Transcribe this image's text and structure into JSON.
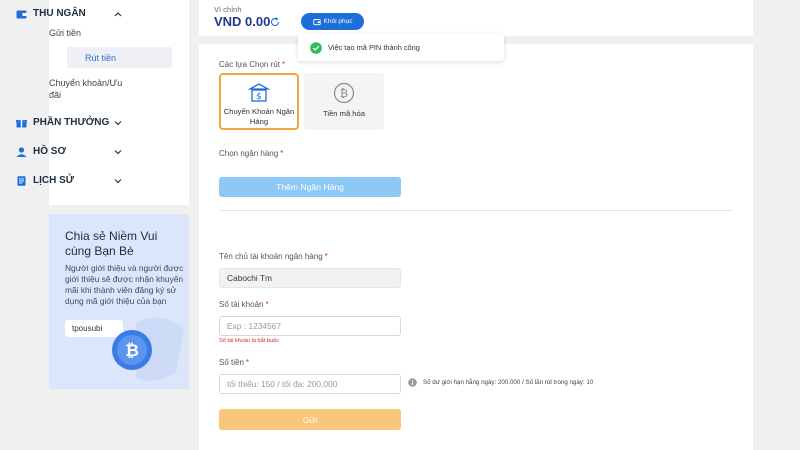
{
  "sidebar": {
    "sections": {
      "cashier": {
        "label": "THU NGÂN",
        "sub": [
          "Gửi tiền",
          "Rút tiền",
          "Chuyển khoản/Ưu đãi"
        ]
      },
      "rewards": {
        "label": "PHẦN THƯỞNG"
      },
      "profile": {
        "label": "HỒ SƠ"
      },
      "history": {
        "label": "LỊCH SỬ"
      }
    },
    "share": {
      "title": "Chia sẻ Niềm Vui cùng Bạn Bè",
      "description": "Người giới thiệu và người được giới thiệu sẽ được nhận khuyến mãi khi thành viên đăng ký sử dụng mã giới thiệu của bạn",
      "code": "tpousubi"
    }
  },
  "wallet": {
    "label": "Ví chính",
    "amount": "VND 0.00",
    "restore_label": "Khôi phục"
  },
  "toast": {
    "message": "Việc tạo mã PIN thành công"
  },
  "form": {
    "withdraw_options_label": "Các lựa Chọn rút",
    "options": [
      {
        "label": "Chuyển Khoản Ngân Hàng"
      },
      {
        "label": "Tiền mã hóa"
      }
    ],
    "bank_label": "Chọn ngân hàng",
    "add_bank_label": "Thêm Ngân Hàng",
    "account_holder_label": "Tên chủ tài khoản ngân hàng",
    "account_holder_value": "Cabochi Tm",
    "account_number_label": "Số tài khoản",
    "account_number_placeholder": "Exp : 1234567",
    "account_number_error": "Số tài khoản là bắt buộc",
    "amount_label": "Số tiền",
    "amount_placeholder": "tối thiểu: 150 / tối đa: 200,000",
    "limit_info": "Số dư giới hạn hằng ngày: 200.000 / Số lần rút trong ngày: 10",
    "submit_label": "Gửi",
    "required_mark": "*"
  },
  "colors": {
    "primary": "#1d6ed8",
    "accent": "#f2a93b",
    "success": "#2ebd59",
    "error": "#e02424"
  }
}
